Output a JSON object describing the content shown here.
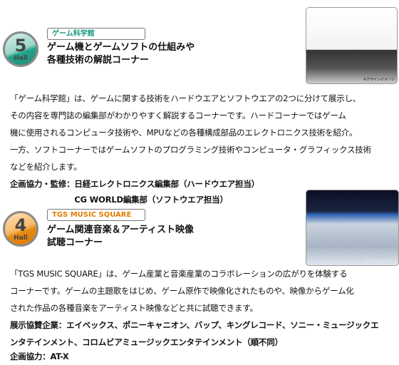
{
  "sections": [
    {
      "hall_number": "5",
      "hall_label": "Hall",
      "tag": "ゲーム科学館",
      "title_lines": [
        "ゲーム機とゲームソフトの仕組みや",
        "各種技術の解説コーナー"
      ],
      "image_caption": "※デザインイメージ",
      "body_lines": [
        "「ゲーム科学館」は、ゲームに関する技術をハードウエアとソフトウエアの2つに分けて展示し、",
        "その内容を専門誌の編集部がわかりやすく解説するコーナーです。ハードコーナーではゲーム",
        "機に使用されるコンピュータ技術や、MPUなどの各種構成部品のエレクトロニクス技術を紹介。",
        "一方、ソフトコーナーではゲームソフトのプログラミング技術やコンピュータ・グラフィックス技術",
        "などを紹介します。",
        "企画協力・監修：日経エレクトロニクス編集部（ハードウエア担当）",
        "　　　　　　　　CG WORLD編集部（ソフトウエア担当）"
      ]
    },
    {
      "hall_number": "4",
      "hall_label": "Hall",
      "tag": "TGS MUSIC SQUARE",
      "title_lines": [
        "ゲーム関連音楽＆アーティスト映像",
        "試聴コーナー"
      ],
      "image_caption": "※デザインイメージ",
      "body_lines": [
        "「TGS MUSIC SQUARE」は、ゲーム産業と音楽産業のコラボレーションの広がりを体験する",
        "コーナーです。ゲームの主題歌をはじめ、ゲーム原作で映像化されたものや、映像からゲーム化",
        "された作品の各種音楽をアーティスト映像などと共に試聴できます。",
        "展示協賛企業：エイベックス、ポニーキャニオン、バップ、キングレコード、ソニー・ミュージックエ",
        "ンタテインメント、コロムビアミュージックエンタテインメント（順不同）",
        "企画協力：AT-X"
      ]
    }
  ]
}
